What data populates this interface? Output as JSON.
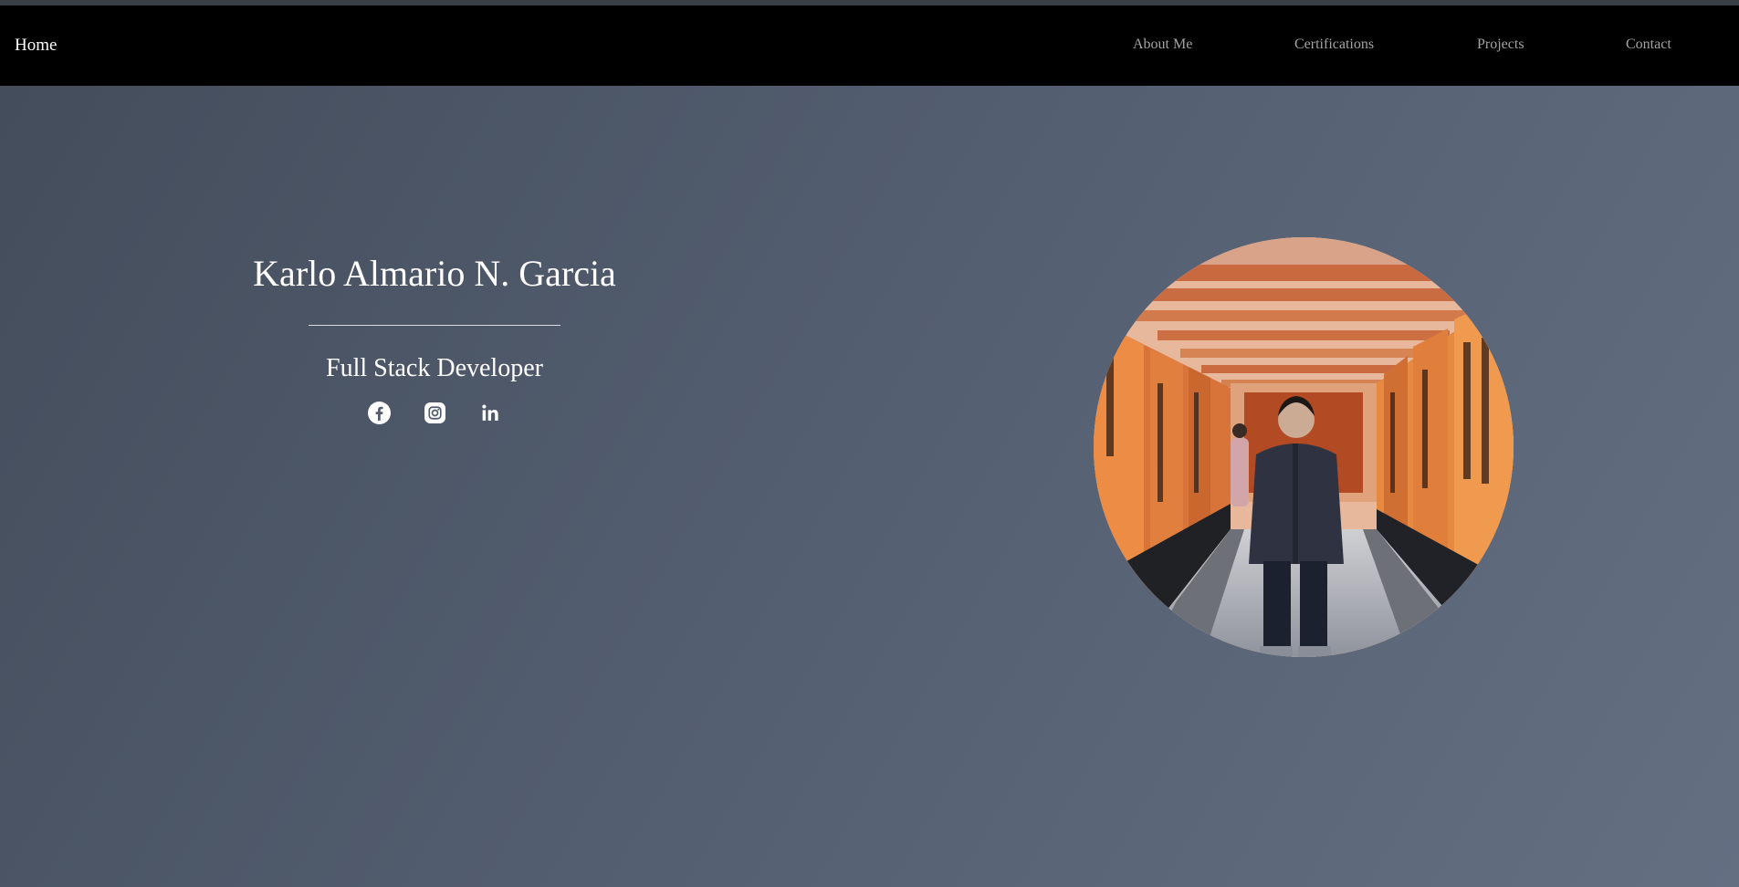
{
  "nav": {
    "home": "Home",
    "links": [
      "About Me",
      "Certifications",
      "Projects",
      "Contact"
    ]
  },
  "hero": {
    "name": "Karlo Almario N. Garcia",
    "role": "Full Stack Developer"
  },
  "socials": [
    "facebook-icon",
    "instagram-icon",
    "linkedin-icon"
  ],
  "colors": {
    "navbar": "#000000",
    "nav_link": "#a4a4a4",
    "background_start": "#434c5a",
    "background_end": "#646f82",
    "text": "#ffffff"
  }
}
